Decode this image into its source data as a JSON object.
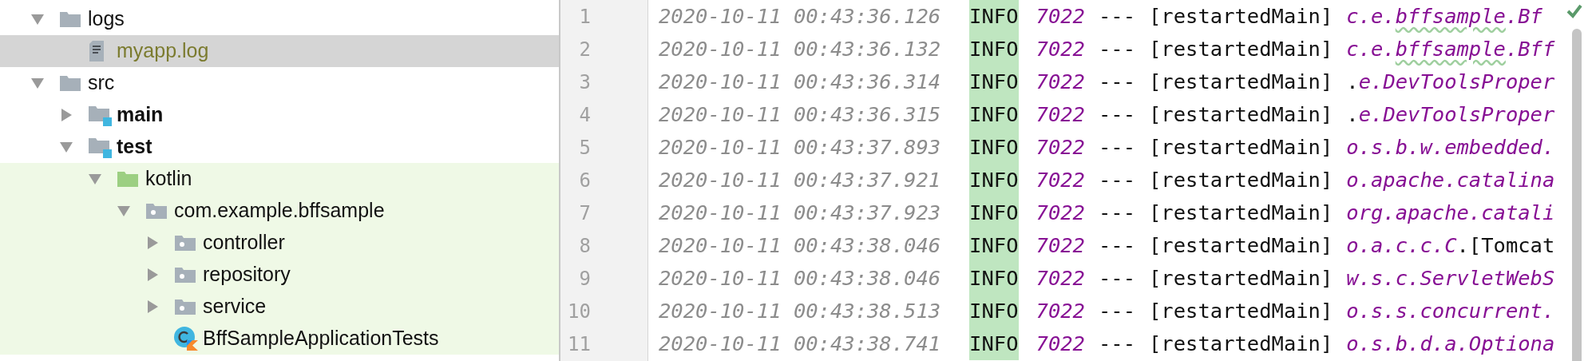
{
  "project_tree": [
    {
      "label": "logs",
      "kind": "folder",
      "expanded": true,
      "selected": false,
      "tinted": false,
      "children": [
        {
          "label": "myapp.log",
          "kind": "log-file",
          "selected": true,
          "ignored": true
        }
      ]
    },
    {
      "label": "src",
      "kind": "folder",
      "expanded": true,
      "selected": false,
      "tinted": false,
      "children": [
        {
          "label": "main",
          "kind": "module-folder",
          "expanded": false,
          "selected": false,
          "tinted": false
        },
        {
          "label": "test",
          "kind": "module-folder",
          "expanded": true,
          "selected": false,
          "tinted": false,
          "children": [
            {
              "label": "kotlin",
              "kind": "test-root",
              "expanded": true,
              "selected": false,
              "tinted": true,
              "children": [
                {
                  "label": "com.example.bffsample",
                  "kind": "package",
                  "expanded": true,
                  "selected": false,
                  "tinted": true,
                  "children": [
                    {
                      "label": "controller",
                      "kind": "package",
                      "expanded": false,
                      "selected": false,
                      "tinted": true
                    },
                    {
                      "label": "repository",
                      "kind": "package",
                      "expanded": false,
                      "selected": false,
                      "tinted": true
                    },
                    {
                      "label": "service",
                      "kind": "package",
                      "expanded": false,
                      "selected": false,
                      "tinted": true
                    },
                    {
                      "label": "BffSampleApplicationTests",
                      "kind": "kotlin-class",
                      "selected": false,
                      "tinted": true
                    }
                  ]
                }
              ]
            }
          ]
        }
      ]
    }
  ],
  "log_lines": [
    {
      "line": "1",
      "timestamp": "2020-10-11 00:43:36.126",
      "level": "INFO",
      "pid": "7022",
      "separator": "---",
      "thread": "[restartedMain]",
      "message": [
        {
          "text": "c.e.",
          "kind": "logger",
          "typo": false
        },
        {
          "text": "bffsample",
          "kind": "logger",
          "typo": true
        },
        {
          "text": ".Bf",
          "kind": "logger",
          "typo": false
        }
      ]
    },
    {
      "line": "2",
      "timestamp": "2020-10-11 00:43:36.132",
      "level": "INFO",
      "pid": "7022",
      "separator": "---",
      "thread": "[restartedMain]",
      "message": [
        {
          "text": "c.e.",
          "kind": "logger",
          "typo": false
        },
        {
          "text": "bffsample",
          "kind": "logger",
          "typo": true
        },
        {
          "text": ".Bff",
          "kind": "logger",
          "typo": false
        }
      ]
    },
    {
      "line": "3",
      "timestamp": "2020-10-11 00:43:36.314",
      "level": "INFO",
      "pid": "7022",
      "separator": "---",
      "thread": "[restartedMain]",
      "message": [
        {
          "text": ".",
          "kind": "plain",
          "typo": false
        },
        {
          "text": "e.DevToolsProper",
          "kind": "logger",
          "typo": false
        }
      ]
    },
    {
      "line": "4",
      "timestamp": "2020-10-11 00:43:36.315",
      "level": "INFO",
      "pid": "7022",
      "separator": "---",
      "thread": "[restartedMain]",
      "message": [
        {
          "text": ".",
          "kind": "plain",
          "typo": false
        },
        {
          "text": "e.DevToolsProper",
          "kind": "logger",
          "typo": false
        }
      ]
    },
    {
      "line": "5",
      "timestamp": "2020-10-11 00:43:37.893",
      "level": "INFO",
      "pid": "7022",
      "separator": "---",
      "thread": "[restartedMain]",
      "message": [
        {
          "text": "o.s.b.w.embedded.",
          "kind": "logger",
          "typo": false
        }
      ]
    },
    {
      "line": "6",
      "timestamp": "2020-10-11 00:43:37.921",
      "level": "INFO",
      "pid": "7022",
      "separator": "---",
      "thread": "[restartedMain]",
      "message": [
        {
          "text": "o.apache.catalina",
          "kind": "logger",
          "typo": false
        }
      ]
    },
    {
      "line": "7",
      "timestamp": "2020-10-11 00:43:37.923",
      "level": "INFO",
      "pid": "7022",
      "separator": "---",
      "thread": "[restartedMain]",
      "message": [
        {
          "text": "org.apache.catali",
          "kind": "logger",
          "typo": false
        }
      ]
    },
    {
      "line": "8",
      "timestamp": "2020-10-11 00:43:38.046",
      "level": "INFO",
      "pid": "7022",
      "separator": "---",
      "thread": "[restartedMain]",
      "message": [
        {
          "text": "o.a.c.c.C",
          "kind": "logger",
          "typo": false
        },
        {
          "text": ".[Tomcat",
          "kind": "plain",
          "typo": false
        }
      ]
    },
    {
      "line": "9",
      "timestamp": "2020-10-11 00:43:38.046",
      "level": "INFO",
      "pid": "7022",
      "separator": "---",
      "thread": "[restartedMain]",
      "message": [
        {
          "text": "w.s.c.ServletWebS",
          "kind": "logger",
          "typo": false
        }
      ]
    },
    {
      "line": "10",
      "timestamp": "2020-10-11 00:43:38.513",
      "level": "INFO",
      "pid": "7022",
      "separator": "---",
      "thread": "[restartedMain]",
      "message": [
        {
          "text": "o.s.s.concurrent.",
          "kind": "logger",
          "typo": false
        }
      ]
    },
    {
      "line": "11",
      "timestamp": "2020-10-11 00:43:38.741",
      "level": "INFO",
      "pid": "7022",
      "separator": "---",
      "thread": "[restartedMain]",
      "message": [
        {
          "text": "o.s.b.d.a.Optiona",
          "kind": "logger",
          "typo": false
        }
      ]
    }
  ]
}
